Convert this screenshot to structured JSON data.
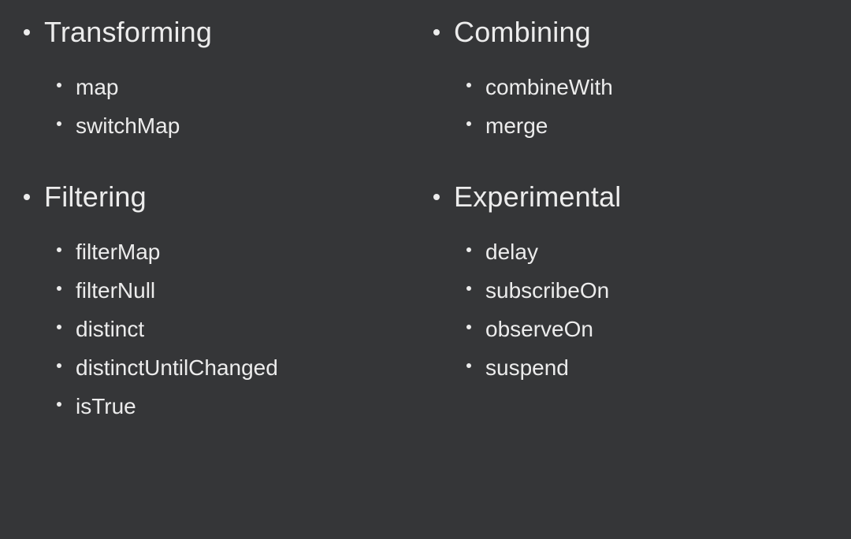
{
  "sections": [
    {
      "title": "Transforming",
      "items": [
        "map",
        "switchMap"
      ]
    },
    {
      "title": "Combining",
      "items": [
        "combineWith",
        "merge"
      ]
    },
    {
      "title": "Filtering",
      "items": [
        "filterMap",
        "filterNull",
        "distinct",
        "distinctUntilChanged",
        "isTrue"
      ]
    },
    {
      "title": "Experimental",
      "items": [
        "delay",
        "subscribeOn",
        "observeOn",
        "suspend"
      ]
    }
  ]
}
